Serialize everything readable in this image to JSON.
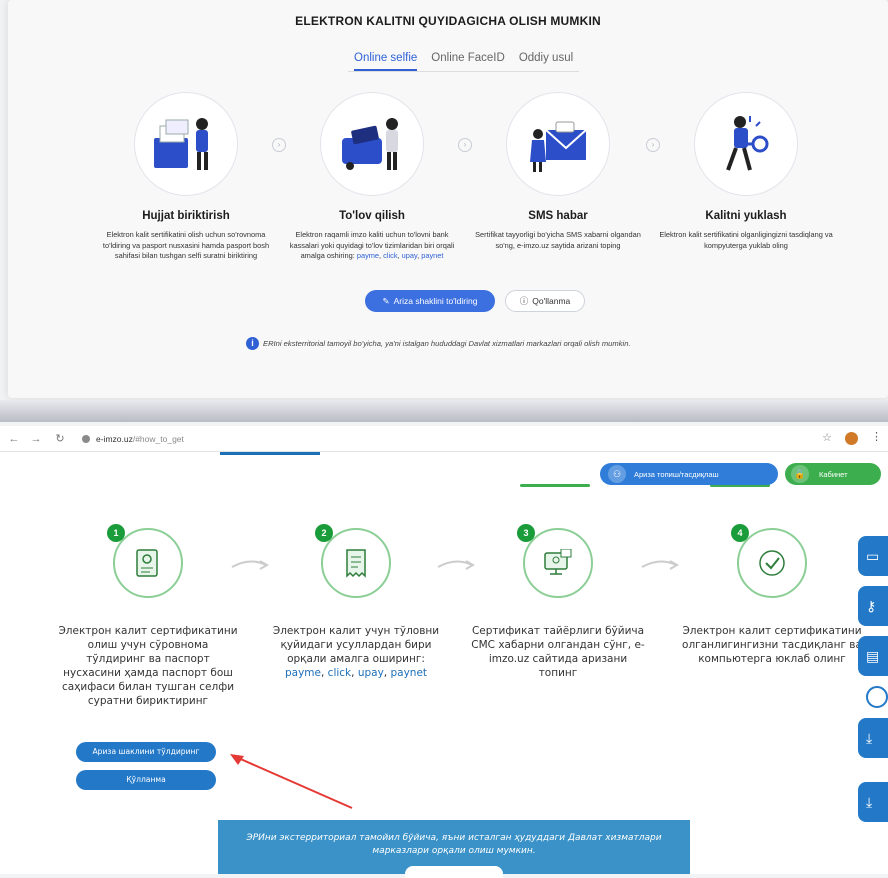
{
  "top": {
    "title": "ELEKTRON KALITNI QUYIDAGICHA OLISH MUMKIN",
    "tabs": [
      {
        "label": "Online selfie",
        "active": true
      },
      {
        "label": "Online FaceID",
        "active": false
      },
      {
        "label": "Oddiy usul",
        "active": false
      }
    ],
    "steps": [
      {
        "title": "Hujjat biriktirish",
        "desc": "Elektron kalit sertifikatini olish uchun so'rovnoma to'ldiring va pasport nusxasini hamda pasport bosh sahifasi bilan tushgan selfi suratni biriktiring"
      },
      {
        "title": "To'lov qilish",
        "desc": "Elektron raqamli imzo kaliti uchun to'lovni bank kassalari yoki quyidagi to'lov tizimlaridan biri orqali amalga oshiring:",
        "links": [
          "payme",
          "click",
          "upay",
          "paynet"
        ]
      },
      {
        "title": "SMS habar",
        "desc": "Sertifikat tayyorligi bo'yicha SMS xabarni olgandan so'ng, e-imzo.uz saytida arizani toping"
      },
      {
        "title": "Kalitni yuklash",
        "desc": "Elektron kalit sertifikatini olganligingizni tasdiqlang va kompyuterga yuklab oling"
      }
    ],
    "primary_button": "Ariza shaklini to'ldiring",
    "secondary_button": "Qo'llanma",
    "note": "ERIni eksterritorial tamoyil bo'yicha, ya'ni istalgan hududdagi Davlat xizmatlari markazlari orqali olish mumkin."
  },
  "browser": {
    "url_host": "e-imzo.uz",
    "url_path": "/#how_to_get"
  },
  "bottom": {
    "header_btn1": "Ариза топиш/тасдиқлаш",
    "header_btn2": "Кабинет",
    "steps": [
      {
        "num": "1",
        "desc": "Электрон калит сертификатини олиш учун сўровнома тўлдиринг ва паспорт нусхасини ҳамда паспорт бош саҳифаси билан тушган селфи суратни бириктиринг"
      },
      {
        "num": "2",
        "desc": "Электрон калит учун тўловни қуйидаги усуллардан бири орқали амалга оширинг:",
        "links": [
          "payme",
          "click",
          "upay",
          "paynet"
        ]
      },
      {
        "num": "3",
        "desc": "Сертификат тайёрлиги бўйича СМС хабарни олгандан сўнг, e-imzo.uz сайтида аризани топинг"
      },
      {
        "num": "4",
        "desc": "Электрон калит сертификатини олганлигингизни тасдиқланг ва компьютерга юклаб олинг"
      }
    ],
    "btn_form": "Ариза шаклини тўлдиринг",
    "btn_guide": "Қўлланма",
    "banner": "ЭРИни экстерриториал тамойил бўйича, яъни исталган ҳудуддаги Давлат хизматлари марказлари орқали олиш мумкин."
  },
  "colors": {
    "accent_blue": "#2f61d5",
    "site_blue": "#2378c8",
    "site_green": "#3dae4e",
    "annotation_red": "#e53935"
  }
}
